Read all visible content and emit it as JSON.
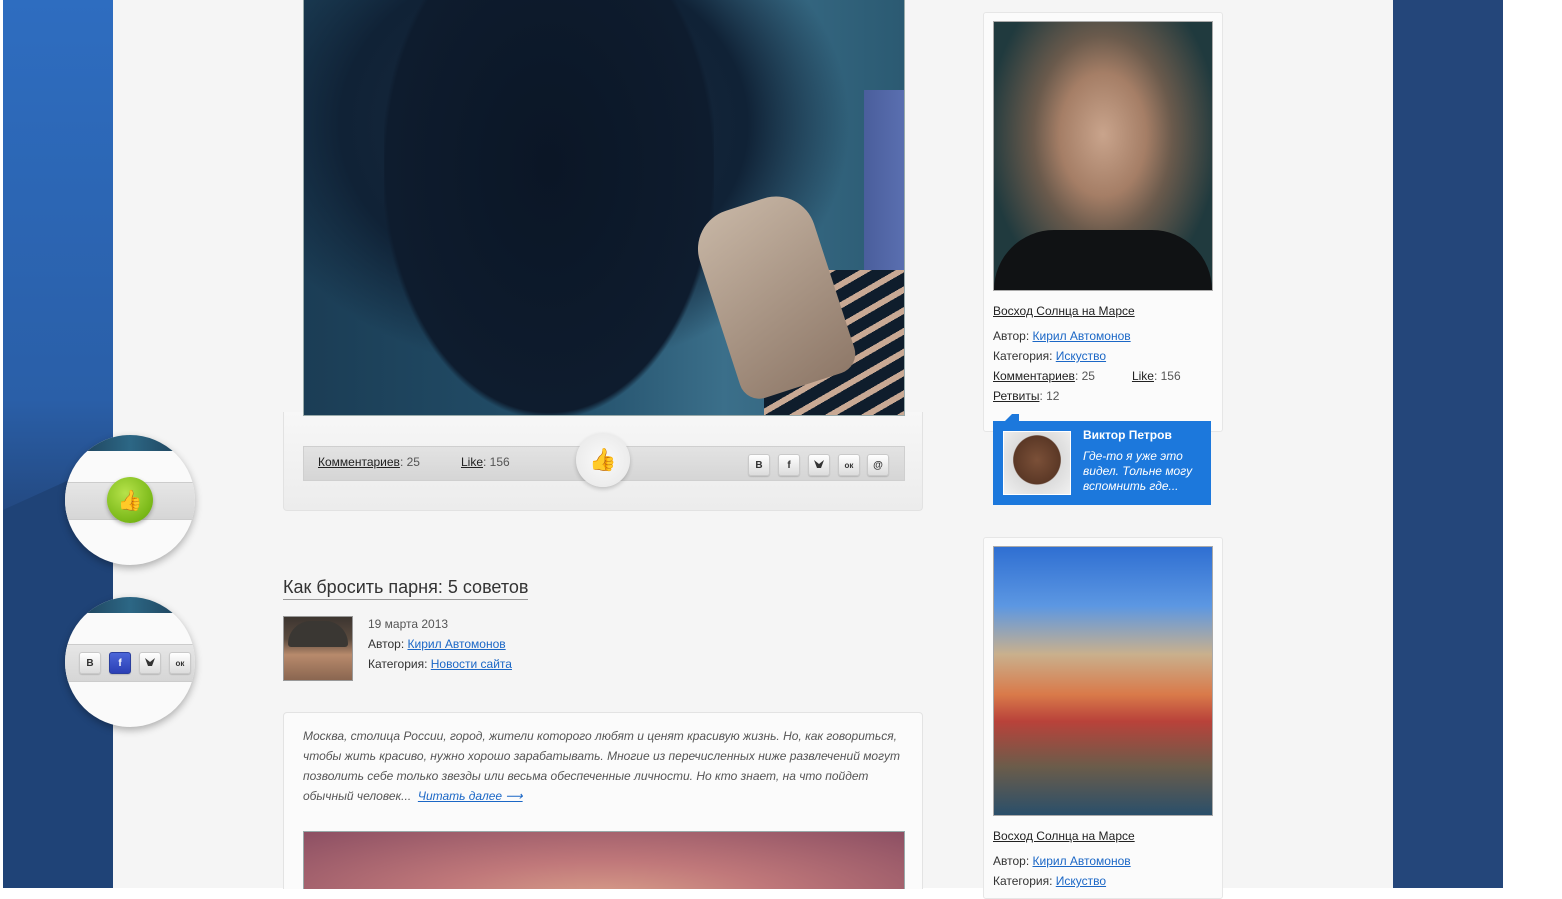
{
  "post1": {
    "comments_label": "Комментариев",
    "comments_count": ": 25",
    "like_label": "Like",
    "like_count": ": 156"
  },
  "social": [
    "В",
    "f",
    "",
    "ок",
    "@"
  ],
  "floating_social": [
    "В",
    "f",
    "",
    "ок"
  ],
  "post2": {
    "title": "Как бросить парня: 5 советов",
    "date": "19 марта 2013",
    "author_label": "Автор: ",
    "author": "Кирил Автомонов",
    "category_label": "Категория: ",
    "category": "Новости сайта",
    "excerpt": "Москва, столица России, город, жители которого любят и ценят красивую жизнь. Но, как говориться, чтобы жить красиво, нужно хорошо зарабатывать. Многие из перечисленных ниже развлечений могут позволить себе только звезды или весьма обеспеченные личности. Но кто знает, на что пойдет обычный человек...",
    "read_more": "Читать далее ⟶"
  },
  "sidebar": {
    "card1": {
      "title": "Восход Солнца на Марсе",
      "author_label": "Автор: ",
      "author": "Кирил Автомонов",
      "category_label": "Категория: ",
      "category": "Искуство",
      "comments_label": "Комментариев",
      "comments_count": ": 25",
      "like_label": "Like",
      "like_count": ": 156",
      "retweets_label": "Ретвиты",
      "retweets_count": ": 12",
      "comment": {
        "name": "Виктор Петров",
        "text": "Где-то я уже это видел. Тольне могу вспомнить где..."
      }
    },
    "card2": {
      "title": "Восход Солнца на Марсе",
      "author_label": "Автор: ",
      "author": "Кирил Автомонов",
      "category_label": "Категория: ",
      "category": "Искуство"
    }
  },
  "colors": {
    "accent": "#1c78dc",
    "link": "#1b67c6",
    "like_green": "#79b818",
    "side_blue": "#2a5fa8"
  },
  "icons": [
    "thumbs-up-icon",
    "vk-icon",
    "facebook-icon",
    "twitter-icon",
    "odnoklassniki-icon",
    "email-icon"
  ]
}
